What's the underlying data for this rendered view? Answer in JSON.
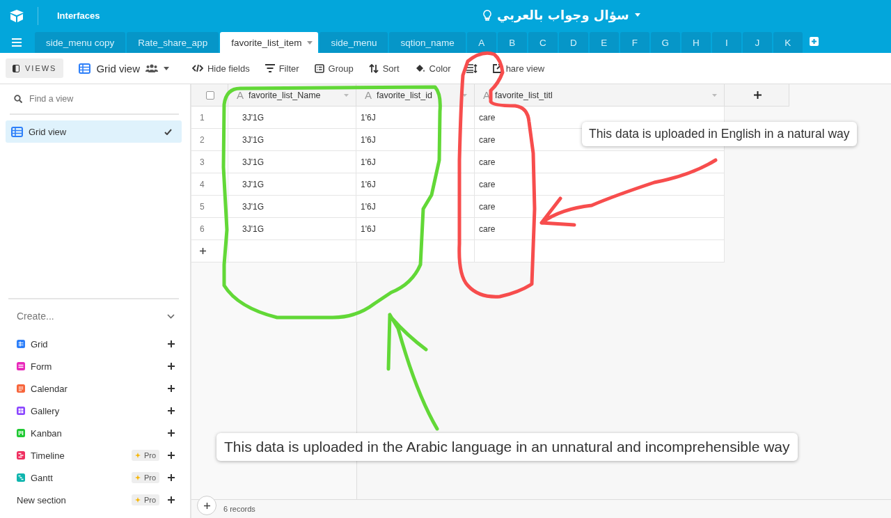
{
  "topbar": {
    "section": "Interfaces",
    "base_title": "سؤال وجواب بالعربي"
  },
  "tabs": [
    {
      "label": "side_menu copy",
      "selected": false
    },
    {
      "label": "Rate_share_app",
      "selected": false
    },
    {
      "label": "favorite_list_item",
      "selected": true
    },
    {
      "label": "side_menu",
      "selected": false
    },
    {
      "label": "sqtion_name",
      "selected": false
    },
    {
      "label": "A",
      "selected": false
    },
    {
      "label": "B",
      "selected": false
    },
    {
      "label": "C",
      "selected": false
    },
    {
      "label": "D",
      "selected": false
    },
    {
      "label": "E",
      "selected": false
    },
    {
      "label": "F",
      "selected": false
    },
    {
      "label": "G",
      "selected": false
    },
    {
      "label": "H",
      "selected": false
    },
    {
      "label": "I",
      "selected": false
    },
    {
      "label": "J",
      "selected": false
    },
    {
      "label": "K",
      "selected": false
    }
  ],
  "toolbar": {
    "views_label": "VIEWS",
    "view_name": "Grid view",
    "buttons": [
      {
        "kind": "hide",
        "label": "Hide fields"
      },
      {
        "kind": "filter",
        "label": "Filter"
      },
      {
        "kind": "group",
        "label": "Group"
      },
      {
        "kind": "sort",
        "label": "Sort"
      },
      {
        "kind": "color",
        "label": "Color"
      },
      {
        "kind": "rowheight"
      },
      {
        "kind": "share",
        "label": "hare view"
      }
    ]
  },
  "sidebar": {
    "search": {
      "placeholder": "Find a view"
    },
    "views": [
      {
        "label": "Grid view",
        "selected": true
      }
    ],
    "create_label": "Create...",
    "create_items": [
      {
        "kind": "grid",
        "label": "Grid",
        "color": "#2d7ff9",
        "pro": false
      },
      {
        "kind": "form",
        "label": "Form",
        "color": "#e929ba",
        "pro": false
      },
      {
        "kind": "calendar",
        "label": "Calendar",
        "color": "#f7653b",
        "pro": false
      },
      {
        "kind": "gallery",
        "label": "Gallery",
        "color": "#8b46ff",
        "pro": false
      },
      {
        "kind": "kanban",
        "label": "Kanban",
        "color": "#20c933",
        "pro": false
      },
      {
        "kind": "timeline",
        "label": "Timeline",
        "color": "#ef3061",
        "pro": true,
        "pro_label": "Pro"
      },
      {
        "kind": "gantt",
        "label": "Gantt",
        "color": "#0fb5ae",
        "pro": true,
        "pro_label": "Pro"
      },
      {
        "kind": "section",
        "label": "New section",
        "pro": true,
        "pro_label": "Pro"
      }
    ]
  },
  "grid": {
    "select_all_checked": false,
    "columns": [
      {
        "type_icon": "A",
        "name": "favorite_list_Name"
      },
      {
        "type_icon": "A",
        "name": "favorite_list_id"
      },
      {
        "type_icon": "A",
        "name": "favorite_list_titl"
      }
    ],
    "rows": [
      {
        "number": "1",
        "cells": [
          "3J'1G",
          "1'6J",
          "care"
        ]
      },
      {
        "number": "2",
        "cells": [
          "3J'1G",
          "1'6J",
          "care"
        ]
      },
      {
        "number": "3",
        "cells": [
          "3J'1G",
          "1'6J",
          "care"
        ]
      },
      {
        "number": "4",
        "cells": [
          "3J'1G",
          "1'6J",
          "care"
        ]
      },
      {
        "number": "5",
        "cells": [
          "3J'1G",
          "1'6J",
          "care"
        ]
      },
      {
        "number": "6",
        "cells": [
          "3J'1G",
          "1'6J",
          "care"
        ]
      }
    ],
    "records": "6 records"
  },
  "annotations": [
    {
      "kind": "callout_top",
      "text": "This data is uploaded in English in a natural way"
    },
    {
      "kind": "callout_bottom",
      "text": "This data is uploaded in the Arabic language in an unnatural and incomprehensible way"
    }
  ]
}
